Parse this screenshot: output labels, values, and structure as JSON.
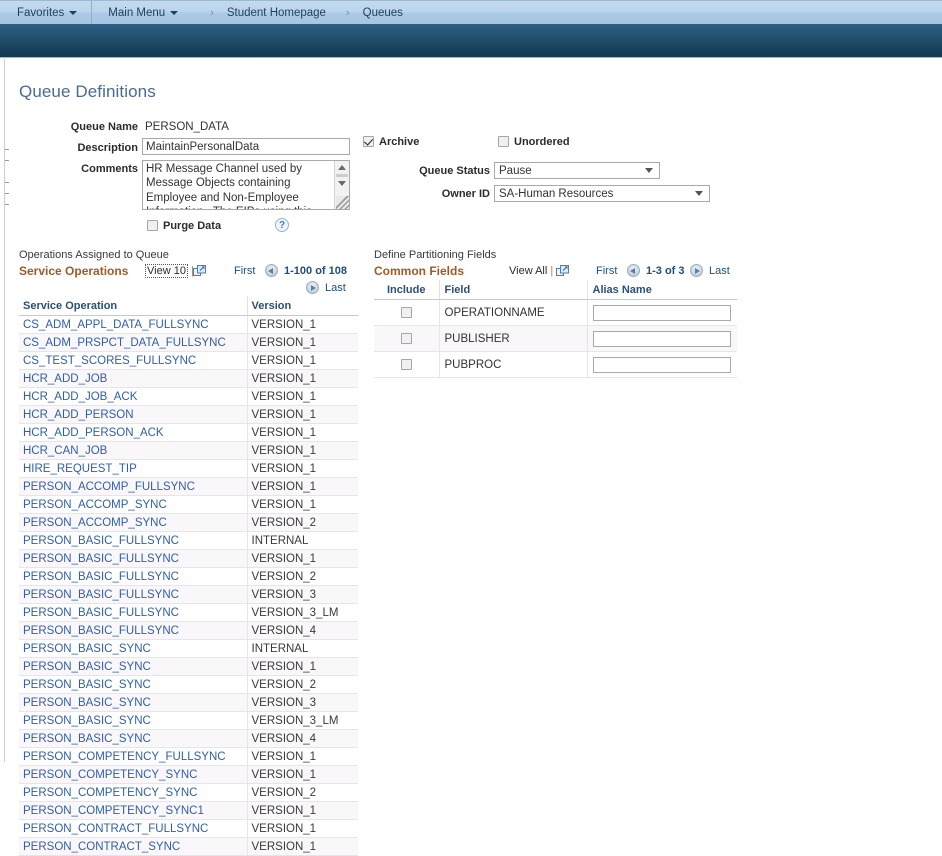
{
  "navbar": {
    "favorites": "Favorites",
    "main_menu": "Main Menu",
    "crumb_chevron": "›",
    "breadcrumb": [
      "Student Homepage",
      "Queues"
    ]
  },
  "page": {
    "title": "Queue Definitions"
  },
  "form": {
    "queue_name_label": "Queue Name",
    "queue_name_value": "PERSON_DATA",
    "description_label": "Description",
    "description_value": "MaintainPersonalData",
    "comments_label": "Comments",
    "comments_value": "HR Message Channel used by Message Objects containing Employee and Non-Employee Information.  The EIPs using this",
    "purge_data_label": "Purge Data",
    "purge_data_checked": false,
    "help_icon": "?",
    "archive_label": "Archive",
    "archive_checked": true,
    "unordered_label": "Unordered",
    "unordered_checked": false,
    "queue_status_label": "Queue Status",
    "queue_status_value": "Pause",
    "owner_id_label": "Owner ID",
    "owner_id_value": "SA-Human Resources"
  },
  "operations_grid": {
    "caption": "Operations Assigned to Queue",
    "title": "Service Operations",
    "view_link": "View 10",
    "separator": "|",
    "expand_icon": "expand-grid-icon",
    "first_label": "First",
    "range_label": "1-100 of 108",
    "last_label": "Last",
    "columns": [
      "Service Operation",
      "Version"
    ],
    "rows": [
      [
        "CS_ADM_APPL_DATA_FULLSYNC",
        "VERSION_1"
      ],
      [
        "CS_ADM_PRSPCT_DATA_FULLSYNC",
        "VERSION_1"
      ],
      [
        "CS_TEST_SCORES_FULLSYNC",
        "VERSION_1"
      ],
      [
        "HCR_ADD_JOB",
        "VERSION_1"
      ],
      [
        "HCR_ADD_JOB_ACK",
        "VERSION_1"
      ],
      [
        "HCR_ADD_PERSON",
        "VERSION_1"
      ],
      [
        "HCR_ADD_PERSON_ACK",
        "VERSION_1"
      ],
      [
        "HCR_CAN_JOB",
        "VERSION_1"
      ],
      [
        "HIRE_REQUEST_TIP",
        "VERSION_1"
      ],
      [
        "PERSON_ACCOMP_FULLSYNC",
        "VERSION_1"
      ],
      [
        "PERSON_ACCOMP_SYNC",
        "VERSION_1"
      ],
      [
        "PERSON_ACCOMP_SYNC",
        "VERSION_2"
      ],
      [
        "PERSON_BASIC_FULLSYNC",
        "INTERNAL"
      ],
      [
        "PERSON_BASIC_FULLSYNC",
        "VERSION_1"
      ],
      [
        "PERSON_BASIC_FULLSYNC",
        "VERSION_2"
      ],
      [
        "PERSON_BASIC_FULLSYNC",
        "VERSION_3"
      ],
      [
        "PERSON_BASIC_FULLSYNC",
        "VERSION_3_LM"
      ],
      [
        "PERSON_BASIC_FULLSYNC",
        "VERSION_4"
      ],
      [
        "PERSON_BASIC_SYNC",
        "INTERNAL"
      ],
      [
        "PERSON_BASIC_SYNC",
        "VERSION_1"
      ],
      [
        "PERSON_BASIC_SYNC",
        "VERSION_2"
      ],
      [
        "PERSON_BASIC_SYNC",
        "VERSION_3"
      ],
      [
        "PERSON_BASIC_SYNC",
        "VERSION_3_LM"
      ],
      [
        "PERSON_BASIC_SYNC",
        "VERSION_4"
      ],
      [
        "PERSON_COMPETENCY_FULLSYNC",
        "VERSION_1"
      ],
      [
        "PERSON_COMPETENCY_SYNC",
        "VERSION_1"
      ],
      [
        "PERSON_COMPETENCY_SYNC",
        "VERSION_2"
      ],
      [
        "PERSON_COMPETENCY_SYNC1",
        "VERSION_1"
      ],
      [
        "PERSON_CONTRACT_FULLSYNC",
        "VERSION_1"
      ],
      [
        "PERSON_CONTRACT_SYNC",
        "VERSION_1"
      ]
    ]
  },
  "partition_grid": {
    "caption": "Define Partitioning Fields",
    "title": "Common Fields",
    "view_link": "View All",
    "separator": "|",
    "expand_icon": "expand-grid-icon",
    "first_label": "First",
    "range_label": "1-3 of 3",
    "last_label": "Last",
    "columns": [
      "Include",
      "Field",
      "Alias Name"
    ],
    "rows": [
      {
        "include": false,
        "field": "OPERATIONNAME",
        "alias": ""
      },
      {
        "include": false,
        "field": "PUBLISHER",
        "alias": ""
      },
      {
        "include": false,
        "field": "PUBPROC",
        "alias": ""
      }
    ]
  },
  "colors": {
    "nav_bg": "#bcd5ec",
    "navy_band": "#1c4a68",
    "title_blue": "#4a6a92",
    "grid_title_orange": "#a05a28",
    "link_blue": "#2f5fa8",
    "header_blue": "#2d4f73"
  }
}
